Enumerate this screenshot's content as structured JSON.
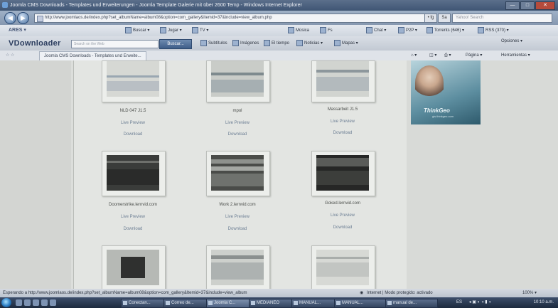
{
  "window": {
    "title": "Joomla CMS Downloads - Templates und Erweiterungen - Joomla Template Galerie mit über 2600 Temp - Windows Internet Explorer",
    "minimize": "—",
    "maximize": "□",
    "close": "✕"
  },
  "nav": {
    "back": "◀",
    "forward": "▶",
    "address": "http://www.joomlaos.de/index.php?set_albumName=album08&option=com_gallery&Itemid=37&include=view_album.php",
    "compat_label": "• fg",
    "refresh_label": "Sa",
    "search_placeholder": "Yahoo! Search"
  },
  "toolbar1": {
    "brand": "ARES ▾",
    "items": [
      "Buscar ▾",
      "Jugar ▾",
      "TV ▾",
      "Música",
      "Fs",
      "Chat ▾",
      "P2P ▾",
      "Torrents (646) ▾",
      "RSS (370) ▾"
    ],
    "options": "Opciones ▾"
  },
  "toolbar2": {
    "brand": "VDownloader",
    "search_placeholder": "Search on the Web",
    "search_button": "Buscar...",
    "items": [
      "Subtítulos",
      "Imágenes",
      "El tiempo",
      "Noticias ▾",
      "Mapas ▾"
    ]
  },
  "tabs": {
    "active_tab": "Joomla CMS Downloads - Templates und Erweite...",
    "commands": [
      "Página ▾",
      "Herramientas ▾"
    ]
  },
  "templates": [
    {
      "name": "NLD 047 J1.5",
      "preview": "Live Preview",
      "download": "Download"
    },
    {
      "name": "mpol",
      "preview": "Live Preview",
      "download": "Download"
    },
    {
      "name": "Massarbeit J1.5",
      "preview": "Live Preview",
      "download": "Download"
    },
    {
      "name": "Doomerstrike.lernvid.com",
      "preview": "Live Preview",
      "download": "Download"
    },
    {
      "name": "Work 2.lernvid.com",
      "preview": "Live Preview",
      "download": "Download"
    },
    {
      "name": "Goked.lernvid.com",
      "preview": "Live Preview",
      "download": "Download"
    }
  ],
  "ad": {
    "brand": "ThinkGeo",
    "sub": "gis.thinkgeo.com"
  },
  "status": {
    "text": "Esperando a http://www.joomlaos.de/index.php?set_albumName=album08&option=com_gallery&Itemid=37&include=view_album",
    "zone": "Internet | Modo protegido: activado",
    "zoom": "100% ▾"
  },
  "taskbar": {
    "tasks": [
      "Conectan...",
      "Correo de...",
      "Joomla C...",
      "MEDIANEO",
      "MANUAL...",
      "MANUAL...",
      "manual de..."
    ],
    "lang": "ES",
    "clock": "10:10 a.m."
  }
}
